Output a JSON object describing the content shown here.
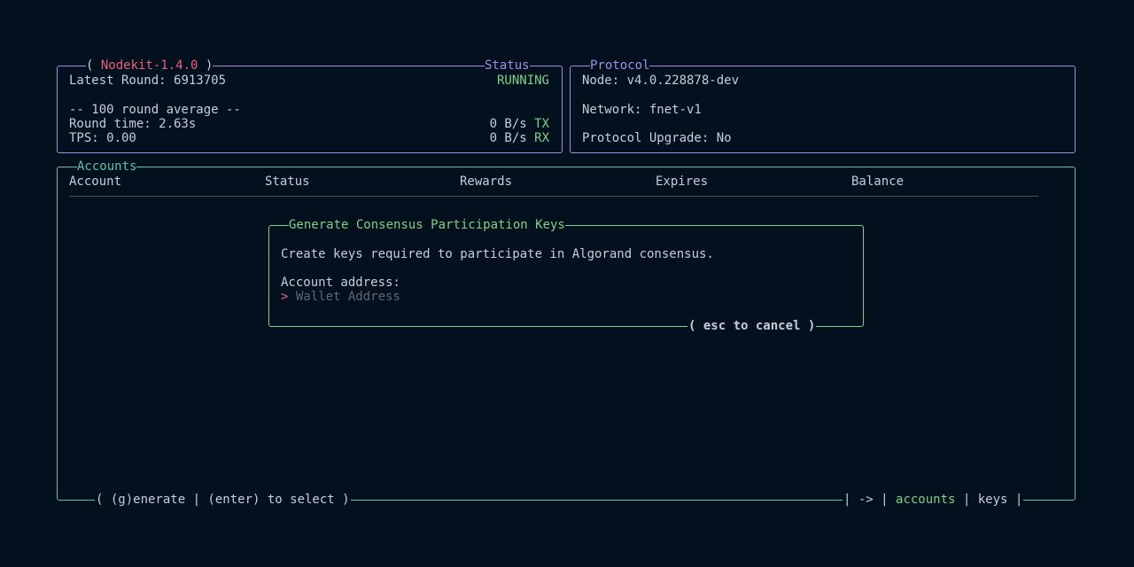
{
  "colors": {
    "background": "#03111f",
    "text": "#c8ccd9",
    "purple": "#a48ce8",
    "pink": "#e8607a",
    "green": "#7fcf8a",
    "teal": "#5fc3a3",
    "dim": "#5f6670"
  },
  "status_panel": {
    "title_open": "( ",
    "app_name": "Nodekit-1.4.0",
    "title_close": " )",
    "label": "Status",
    "latest_round_label": "Latest Round: ",
    "latest_round": "6913705",
    "state": "RUNNING",
    "average_heading": "-- 100 round average --",
    "round_time": "Round time: 2.63s",
    "tps": "TPS: 0.00",
    "tx_rate": "0 B/s ",
    "tx_label": "TX",
    "rx_rate": "0 B/s ",
    "rx_label": "RX"
  },
  "protocol_panel": {
    "title": "Protocol",
    "node": "Node: v4.0.228878-dev",
    "network": "Network: fnet-v1",
    "upgrade": "Protocol Upgrade: No"
  },
  "accounts_panel": {
    "title": "Accounts",
    "columns": [
      "Account",
      "Status",
      "Rewards",
      "Expires",
      "Balance"
    ],
    "footer_left": "( (g)enerate | (enter) to select )",
    "footer_nav_prefix": "| -> | ",
    "footer_nav_accounts": "accounts",
    "footer_nav_sep": " | ",
    "footer_nav_keys": "keys",
    "footer_nav_suffix": " |"
  },
  "generate_dialog": {
    "title": "Generate Consensus Participation Keys",
    "description": "Create keys required to participate in Algorand consensus.",
    "address_label": "Account address:",
    "prompt": "> ",
    "address_placeholder": "Wallet Address",
    "cancel_hint": "( esc to cancel )"
  }
}
